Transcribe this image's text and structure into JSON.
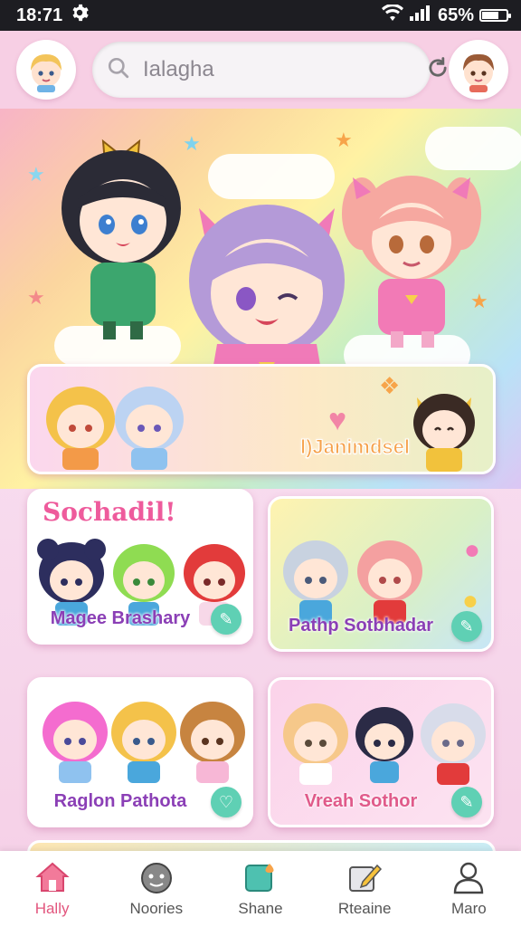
{
  "status_bar": {
    "time": "18:71",
    "battery": "65%",
    "battery_level": 0.65
  },
  "header": {
    "search": {
      "value": "Ialagha"
    }
  },
  "banner": {
    "title": "l)Janimdsel"
  },
  "grid": {
    "heading": "Sochadil!",
    "cards": [
      {
        "label": "Magee Brashary"
      },
      {
        "label": "Pathp Sotbhadar"
      },
      {
        "label": "Raglon Pathota"
      },
      {
        "label": "Vreah Sothor"
      }
    ]
  },
  "nav": {
    "items": [
      {
        "label": "Hally",
        "icon": "home-icon"
      },
      {
        "label": "Noories",
        "icon": "face-icon"
      },
      {
        "label": "Shane",
        "icon": "share-icon"
      },
      {
        "label": "Rteaine",
        "icon": "edit-icon"
      },
      {
        "label": "Maro",
        "icon": "profile-icon"
      }
    ]
  },
  "colors": {
    "accent_pink": "#ee5b9c",
    "label_purple": "#8b3fb6",
    "action_green": "#5fd0b4"
  }
}
